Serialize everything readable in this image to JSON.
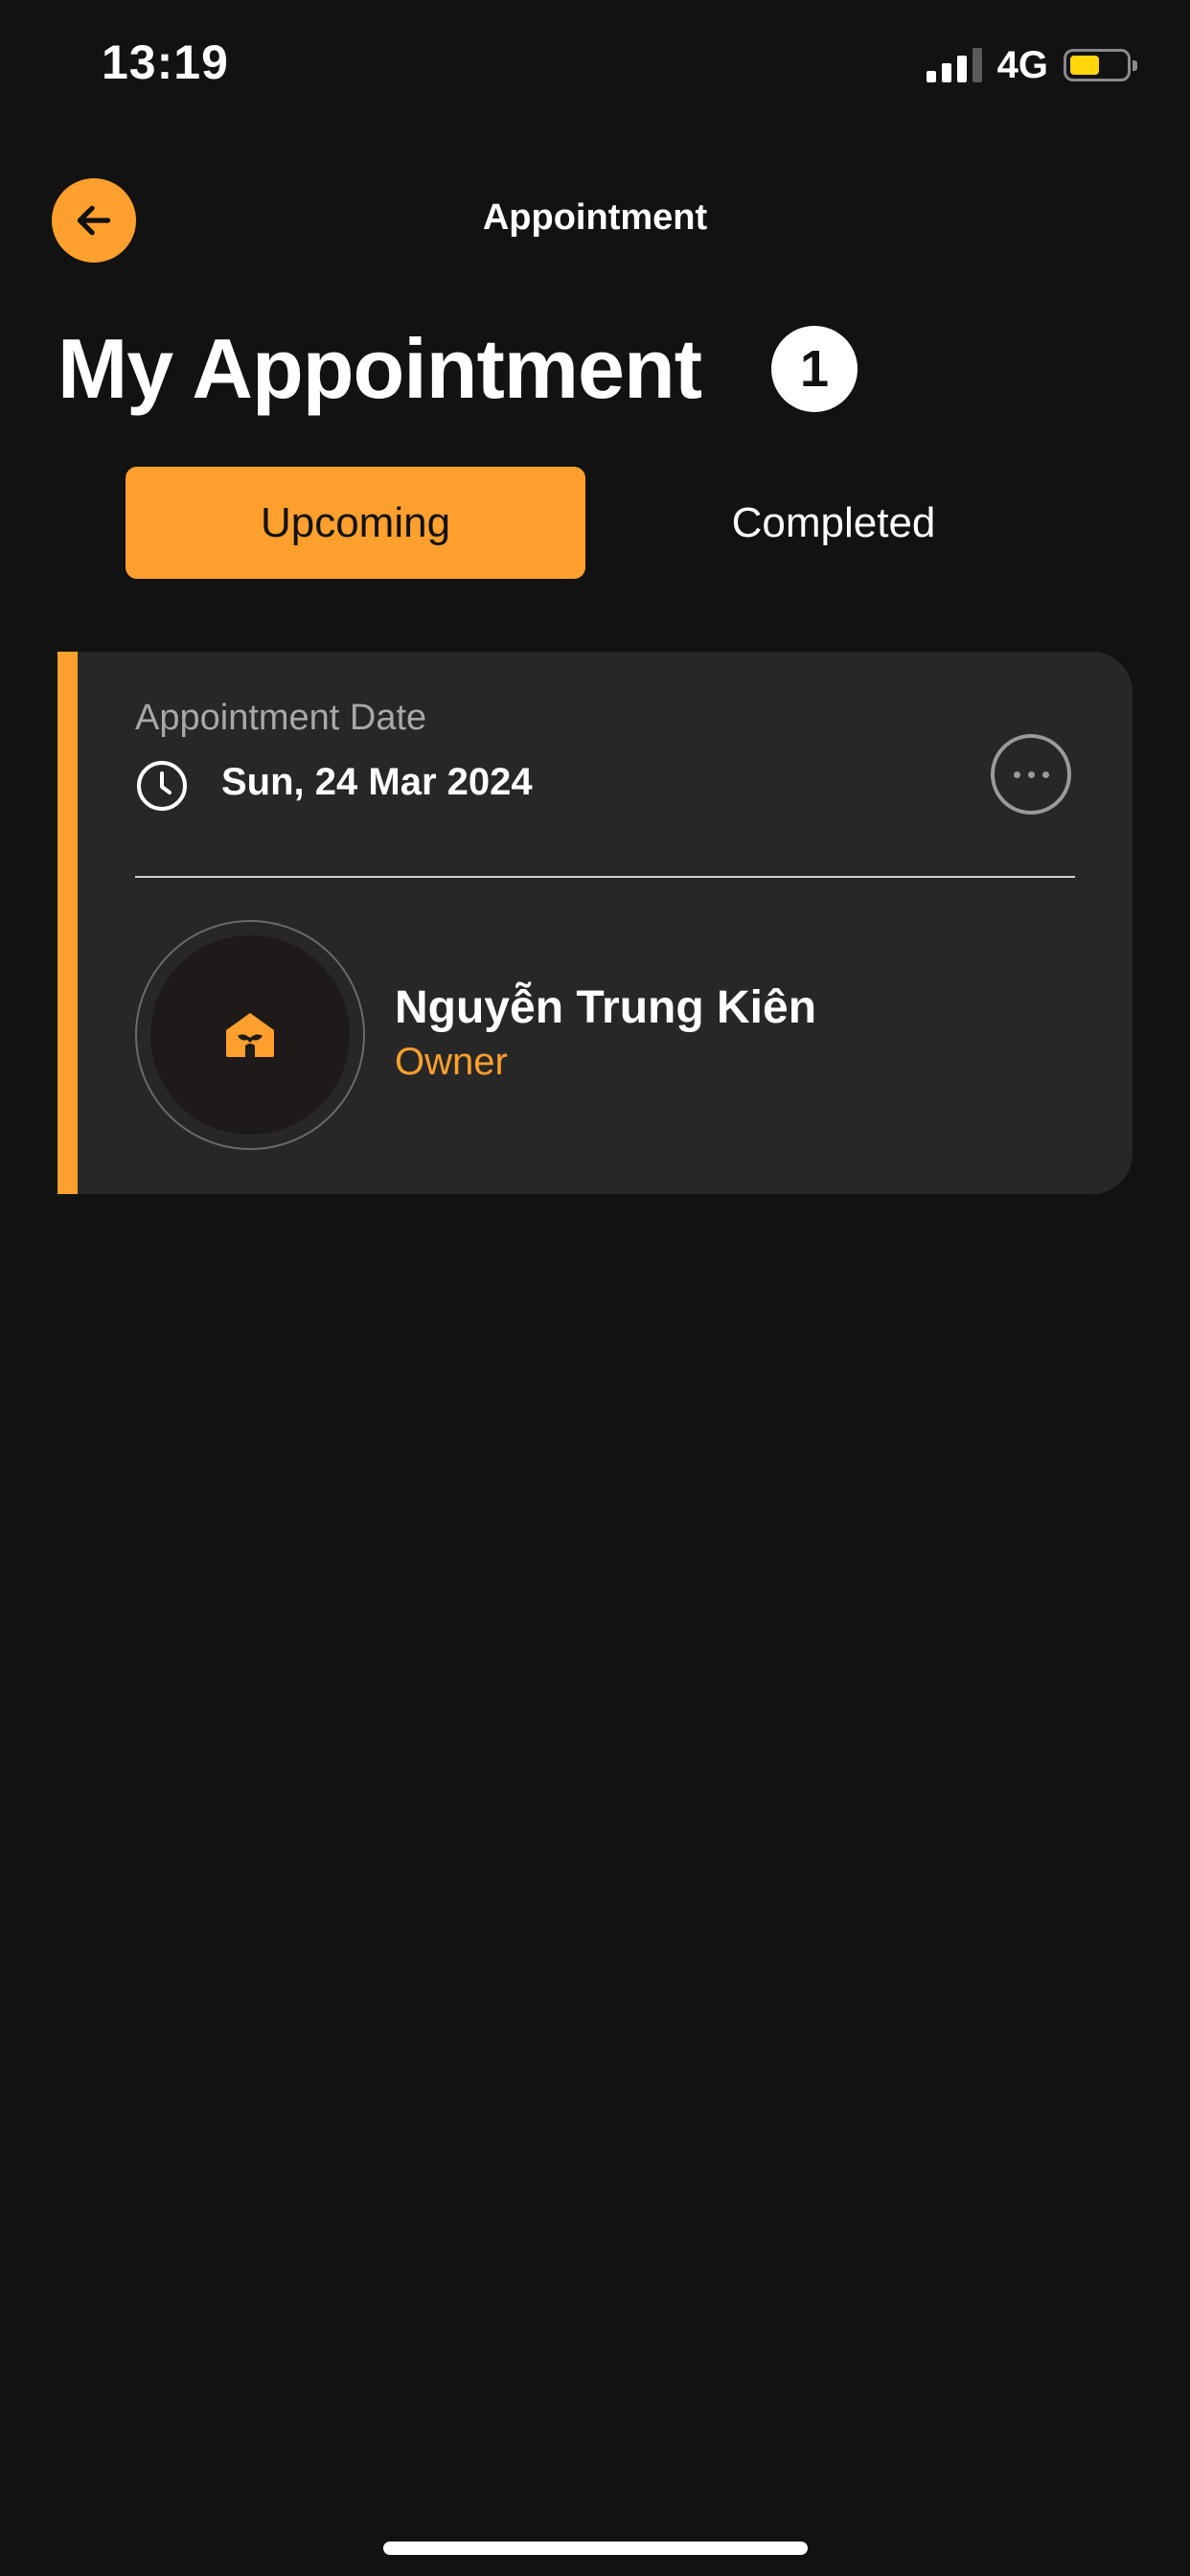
{
  "status_bar": {
    "time": "13:19",
    "network": "4G",
    "battery_level": 0.45,
    "battery_color": "#ffd60a"
  },
  "header": {
    "title": "Appointment",
    "back_icon": "arrow-left-icon"
  },
  "page": {
    "title": "My Appointment",
    "count": "1"
  },
  "tabs": [
    {
      "label": "Upcoming",
      "active": true
    },
    {
      "label": "Completed",
      "active": false
    }
  ],
  "appointments": [
    {
      "date_label": "Appointment Date",
      "date_value": "Sun, 24 Mar 2024",
      "date_icon": "clock-icon",
      "more_icon": "more-horizontal-icon",
      "name": "Nguyễn Trung Kiên",
      "role": "Owner",
      "avatar_icon": "shop-logo-icon"
    }
  ],
  "colors": {
    "accent": "#ffa02e",
    "background": "#121212",
    "card": "#272727"
  }
}
